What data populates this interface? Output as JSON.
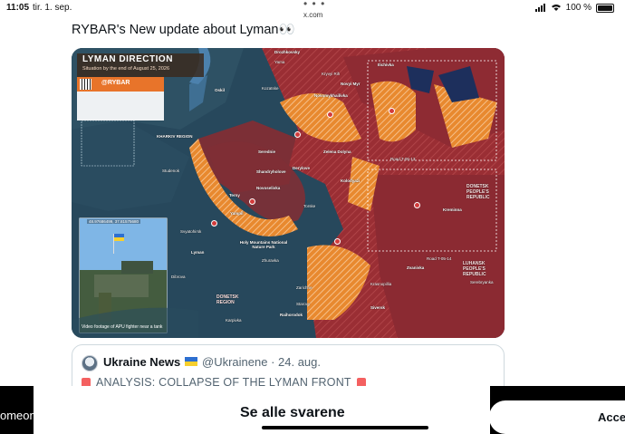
{
  "status_bar": {
    "time": "11:05",
    "date": "tir. 1. sep.",
    "url": "x.com",
    "battery": "100 %"
  },
  "tweet": {
    "text": "RYBAR's New update about Lyman👀"
  },
  "map": {
    "title": "LYMAN DIRECTION",
    "subtitle": "Situation by the end of August 25, 2026",
    "brand": "@RYBAR",
    "inset_coordinates": "48.97686499, 37.81575680",
    "inset_caption": "Video footage of APU fighter near a tank",
    "labels": {
      "yama": "Yama",
      "drozhkovsky": "Drozhkovsky",
      "ilichivka": "Ilichivka",
      "novyi_myr": "Novyi Myr",
      "kryvyi_rih": "Kryvyi Rih",
      "kozatske": "Kozatske",
      "novomykhailivka": "Novomykhailivka",
      "oskil": "Oskil",
      "kharkiv_region": "KHARKIV REGION",
      "studenok": "Studenok",
      "serednie": "Serednie",
      "zelena_dolyna": "Zelena Dolyna",
      "novoselivka": "Novoselivka",
      "derylove": "Derylove",
      "kolodyazi": "Kolodyazi",
      "shandryholove": "Shandryholove",
      "torske": "Torske",
      "terny": "Terny",
      "yampil": "Yampil",
      "holy_mountains": "Holy Mountains National Nature Park",
      "lyman": "Lyman",
      "donetsk_pr": "DONETSK PEOPLE'S REPUBLIC",
      "luhansk_pr": "LUHANSK PEOPLE'S REPUBLIC",
      "donetsk_region": "DONETSK REGION",
      "siversk": "Siversk",
      "zarichne": "Zarichne",
      "kreminna": "Kreminna",
      "svyatohirsk": "Svyatohirsk",
      "raihorodok": "Raihorodok",
      "krasnopillia": "Krasnopillia",
      "serebryanka": "Serebryanka",
      "zhuravka": "Zhuravka",
      "dibrova": "Dibrova",
      "karpivka": "Karpivka",
      "starovy": "Starovy",
      "road_t": "Road T-05-13",
      "road_t2": "Road T-05-14",
      "zvanivka": "Zvanivka"
    }
  },
  "quote": {
    "name": "Ukraine News",
    "handle": "@Ukrainene · 24. aug.",
    "body": "ANALYSIS: COLLAPSE OF THE LYMAN FRONT"
  },
  "bottom_bar": {
    "left_text": "omeone sa... cookies?",
    "sheet_label": "Se alle svarene",
    "accept_label": "Acce"
  }
}
